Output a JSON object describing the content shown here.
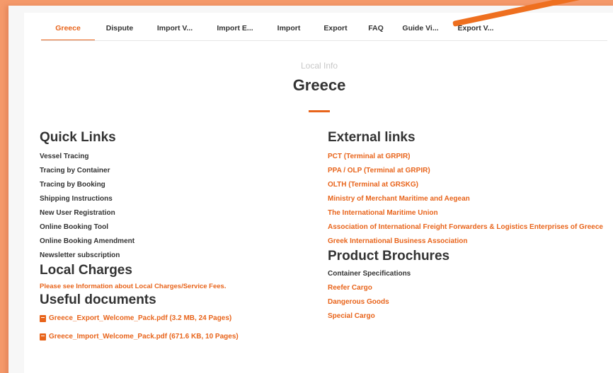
{
  "tabs": [
    {
      "label": "Greece",
      "active": true
    },
    {
      "label": "Dispute",
      "active": false
    },
    {
      "label": "Import V...",
      "active": false
    },
    {
      "label": "Import E...",
      "active": false
    },
    {
      "label": "Import",
      "active": false
    },
    {
      "label": "Export",
      "active": false
    },
    {
      "label": "FAQ",
      "active": false
    },
    {
      "label": "Guide Vi...",
      "active": false
    },
    {
      "label": "Export V...",
      "active": false
    }
  ],
  "header": {
    "subtitle": "Local Info",
    "title": "Greece"
  },
  "quick_links": {
    "heading": "Quick Links",
    "items": [
      "Vessel Tracing",
      "Tracing by Container",
      "Tracing by Booking",
      "Shipping Instructions",
      "New User Registration",
      "Online Booking Tool",
      "Online Booking Amendment",
      "Newsletter subscription"
    ]
  },
  "local_charges": {
    "heading": "Local Charges",
    "notice": "Please see Information about Local Charges/Service Fees."
  },
  "useful_documents": {
    "heading": "Useful documents",
    "items": [
      "Greece_Export_Welcome_Pack.pdf (3.2 MB, 24 Pages)",
      "Greece_Import_Welcome_Pack.pdf (671.6 KB, 10 Pages)"
    ]
  },
  "external_links": {
    "heading": "External links",
    "items": [
      "PCT (Terminal at GRPIR)",
      "PPA / OLP (Terminal at GRPIR)",
      "OLTH (Terminal at GRSKG)",
      "Ministry of Merchant Maritime and Aegean",
      "The International Maritime Union",
      "Association of International Freight Forwarders & Logistics Enterprises of Greece",
      "Greek International Business Association"
    ]
  },
  "product_brochures": {
    "heading": "Product Brochures",
    "items": [
      "Container Specifications",
      "Reefer Cargo",
      "Dangerous Goods",
      "Special Cargo"
    ]
  },
  "colors": {
    "accent": "#e8641b",
    "text": "#333333",
    "background": "#f59a6b"
  }
}
